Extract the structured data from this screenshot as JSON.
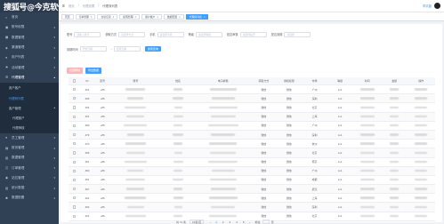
{
  "logo": {
    "text": "搜狐号@今克软件"
  },
  "sidebar": {
    "items": [
      {
        "label": "首页",
        "icon": "home-icon"
      },
      {
        "label": "账号权限",
        "icon": "lock-icon"
      },
      {
        "label": "数据管理",
        "icon": "grid-icon"
      },
      {
        "label": "渠道管理",
        "icon": "share-icon"
      },
      {
        "label": "用户列表",
        "icon": "user-icon"
      },
      {
        "label": "活动管理",
        "icon": "flag-icon"
      },
      {
        "label": "代理管理",
        "icon": "people-icon"
      }
    ],
    "submenu": [
      {
        "label": "用户客户"
      },
      {
        "label": "代理商列表",
        "active": true
      },
      {
        "label": "客户管理"
      }
    ],
    "subsub": [
      {
        "label": "代理客户"
      },
      {
        "label": "代理审核"
      }
    ],
    "bottom_items": [
      {
        "label": "员工管理",
        "icon": "user-icon"
      },
      {
        "label": "财务管理",
        "icon": "wallet-icon"
      },
      {
        "label": "数据管理",
        "icon": "chart-icon"
      },
      {
        "label": "订单管理",
        "icon": "cart-icon"
      },
      {
        "label": "站位管理",
        "icon": "pin-icon"
      },
      {
        "label": "统计数据",
        "icon": "chart-icon"
      },
      {
        "label": "数据配置",
        "icon": "gear-icon"
      }
    ]
  },
  "header": {
    "breadcrumbs": [
      "首页",
      "代理设置",
      "代理商列表"
    ],
    "user_label": "李洪晨"
  },
  "tags": [
    {
      "label": "首页",
      "active": false
    },
    {
      "label": "订单管理",
      "active": false
    },
    {
      "label": "交易记录",
      "active": false
    },
    {
      "label": "提现管理",
      "active": false
    },
    {
      "label": "用户账户",
      "active": false
    },
    {
      "label": "数据配置",
      "active": false
    },
    {
      "label": "代理商列表",
      "active": true
    }
  ],
  "filters": {
    "row1": [
      {
        "label": "账号",
        "placeholder": "请输入账号"
      },
      {
        "label": "获取方式",
        "placeholder": "请选择方式"
      },
      {
        "label": "手机",
        "placeholder": "请选择手机"
      },
      {
        "label": "等级",
        "placeholder": "请选择等级"
      },
      {
        "label": "是否审核",
        "placeholder": "请选择是否"
      },
      {
        "label": "是否到期",
        "placeholder": "请选择"
      }
    ],
    "row2": [
      {
        "label": "到期时间",
        "placeholder": "开始日期"
      },
      {
        "label": "-",
        "placeholder": "结束日期"
      }
    ],
    "search_label": "搜索查询"
  },
  "actions": {
    "delete_label": "批量删除",
    "export_label": "导出数据"
  },
  "table": {
    "columns": [
      "ID",
      "区号",
      "账号",
      "姓名",
      "电子邮箱",
      "获取方式",
      "授权权限",
      "市场",
      "等级",
      "时间",
      "金额",
      "操作"
    ],
    "rows": [
      {
        "id": "461",
        "code": "+86",
        "src": "微信",
        "brand": "微信",
        "city": "广州",
        "lvl": "Lv1"
      },
      {
        "id": "405",
        "code": "+86",
        "src": "微信",
        "brand": "微信",
        "city": "深圳",
        "lvl": "Lv1"
      },
      {
        "id": "404",
        "code": "+86",
        "src": "微信",
        "brand": "微信",
        "city": "北京",
        "lvl": "Lv1"
      },
      {
        "id": "461",
        "code": "+86",
        "src": "微信",
        "brand": "微信",
        "city": "上海",
        "lvl": "Lv1"
      },
      {
        "id": "460",
        "code": "+86",
        "src": "微信",
        "brand": "微信",
        "city": "广州",
        "lvl": "Lv1"
      },
      {
        "id": "479",
        "code": "+86",
        "src": "微信",
        "brand": "微信",
        "city": "深圳",
        "lvl": "Lv1"
      },
      {
        "id": "470",
        "code": "+86",
        "src": "微信",
        "brand": "微信",
        "city": "杭州",
        "lvl": "Lv1"
      },
      {
        "id": "465",
        "code": "+86",
        "src": "微信",
        "brand": "微信",
        "city": "北京",
        "lvl": "Lv1"
      },
      {
        "id": "461",
        "code": "+86",
        "src": "微信",
        "brand": "微信",
        "city": "南京",
        "lvl": "Lv1"
      },
      {
        "id": "460",
        "code": "+86",
        "src": "微信",
        "brand": "微信",
        "city": "广州",
        "lvl": "Lv1"
      },
      {
        "id": "451",
        "code": "+86",
        "src": "微信",
        "brand": "微信",
        "city": "成都",
        "lvl": "Lv1"
      },
      {
        "id": "467",
        "code": "+86",
        "src": "微信",
        "brand": "微信",
        "city": "武汉",
        "lvl": "Lv1"
      },
      {
        "id": "461",
        "code": "+86",
        "src": "微信",
        "brand": "微信",
        "city": "上海",
        "lvl": "Lv1"
      },
      {
        "id": "463",
        "code": "+86",
        "src": "微信",
        "brand": "微信",
        "city": "深圳",
        "lvl": "Lv1"
      },
      {
        "id": "461",
        "code": "+86",
        "src": "微信",
        "brand": "微信",
        "city": "北京",
        "lvl": "Lv1"
      }
    ]
  },
  "pagination": {
    "total_label": "共 71 条",
    "size_label": "15条/页",
    "prev": "‹",
    "pages": [
      "1",
      "2",
      "3",
      "4",
      "5"
    ],
    "current": "1",
    "next": "›",
    "goto_label": "前往",
    "page_suffix": "页"
  },
  "colors": {
    "sidebar": "#304156",
    "accent": "#409eff",
    "danger_light": "#fab6b6"
  }
}
